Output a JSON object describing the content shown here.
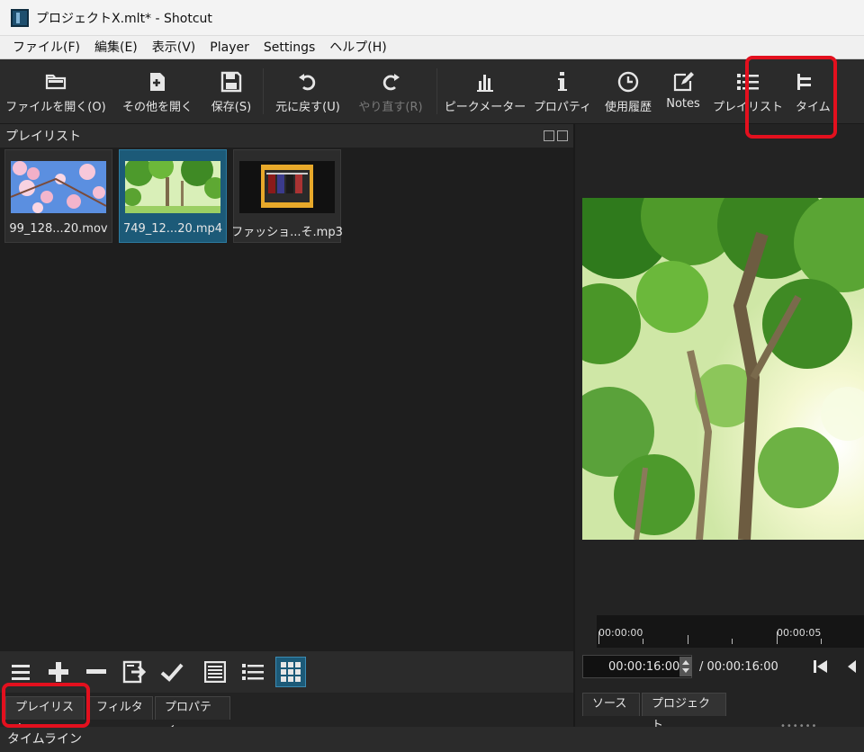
{
  "window": {
    "title": "プロジェクトX.mlt* - Shotcut"
  },
  "menu": [
    "ファイル(F)",
    "編集(E)",
    "表示(V)",
    "Player",
    "Settings",
    "ヘルプ(H)"
  ],
  "toolbar": {
    "open_file": "ファイルを開く(O)",
    "open_other": "その他を開く",
    "save": "保存(S)",
    "undo": "元に戻す(U)",
    "redo": "やり直す(R)",
    "peak_meter": "ピークメーター",
    "properties": "プロパティ",
    "history": "使用履歴",
    "notes": "Notes",
    "playlist": "プレイリスト",
    "timeline": "タイム"
  },
  "playlist_panel": {
    "title": "プレイリスト",
    "items": [
      {
        "label": "99_128...20.mov",
        "selected": false
      },
      {
        "label": "749_12...20.mp4",
        "selected": true
      },
      {
        "label": "ファッショ...そ.mp3",
        "selected": false
      }
    ]
  },
  "left_tabs": [
    "プレイリスト",
    "フィルタ",
    "プロパティ"
  ],
  "statusbar": {
    "label": "タイムライン"
  },
  "player": {
    "ruler_labels": [
      "00:00:00",
      "00:00:05"
    ],
    "current_time": "00:00:16:00",
    "total_time": "/ 00:00:16:00",
    "tabs": [
      "ソース",
      "プロジェクト"
    ]
  },
  "colors": {
    "highlight": "#e3101e",
    "selected": "#1c5a78"
  }
}
